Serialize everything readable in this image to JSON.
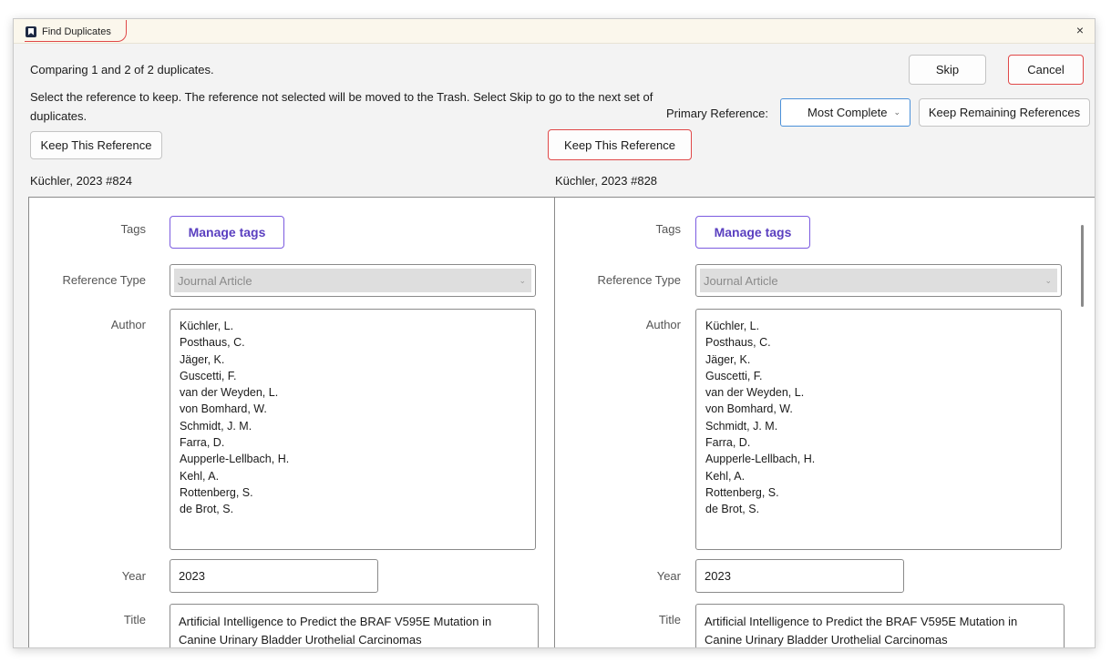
{
  "window": {
    "title": "Find Duplicates",
    "close_glyph": "×"
  },
  "header": {
    "status": "Comparing 1 and 2 of 2 duplicates.",
    "instructions": "Select the reference to keep. The reference not selected will be moved to the Trash. Select Skip to go to the next set of duplicates.",
    "skip_label": "Skip",
    "cancel_label": "Cancel",
    "primary_reference_label": "Primary Reference:",
    "primary_reference_value": "Most Complete",
    "keep_remaining_label": "Keep Remaining References"
  },
  "left": {
    "keep_label": "Keep This Reference",
    "ref_id": "Küchler, 2023 #824",
    "tags_label": "Tags",
    "manage_tags": "Manage tags",
    "reference_type_label": "Reference Type",
    "reference_type": "Journal Article",
    "author_label": "Author",
    "authors": [
      "Küchler, L.",
      "Posthaus, C.",
      "Jäger, K.",
      "Guscetti, F.",
      "van der Weyden, L.",
      "von Bomhard, W.",
      "Schmidt, J. M.",
      "Farra, D.",
      "Aupperle-Lellbach, H.",
      "Kehl, A.",
      "Rottenberg, S.",
      "de Brot, S."
    ],
    "year_label": "Year",
    "year": "2023",
    "title_label": "Title",
    "title": "Artificial Intelligence to Predict the BRAF V595E Mutation in Canine Urinary Bladder Urothelial Carcinomas"
  },
  "right": {
    "keep_label": "Keep This Reference",
    "ref_id": "Küchler, 2023 #828",
    "tags_label": "Tags",
    "manage_tags": "Manage tags",
    "reference_type_label": "Reference Type",
    "reference_type": "Journal Article",
    "author_label": "Author",
    "authors": [
      "Küchler, L.",
      "Posthaus, C.",
      "Jäger, K.",
      "Guscetti, F.",
      "van der Weyden, L.",
      "von Bomhard, W.",
      "Schmidt, J. M.",
      "Farra, D.",
      "Aupperle-Lellbach, H.",
      "Kehl, A.",
      "Rottenberg, S.",
      "de Brot, S."
    ],
    "year_label": "Year",
    "year": "2023",
    "title_label": "Title",
    "title": "Artificial Intelligence to Predict the BRAF V595E Mutation in Canine Urinary Bladder Urothelial Carcinomas"
  },
  "icons": {
    "app": "endnote-app-icon",
    "close": "close-icon",
    "dropdown": "chevron-down-icon"
  },
  "colors": {
    "highlight": "#e04848",
    "manage_tags_accent": "#5a3fc0",
    "select_focus": "#4a90d9"
  }
}
